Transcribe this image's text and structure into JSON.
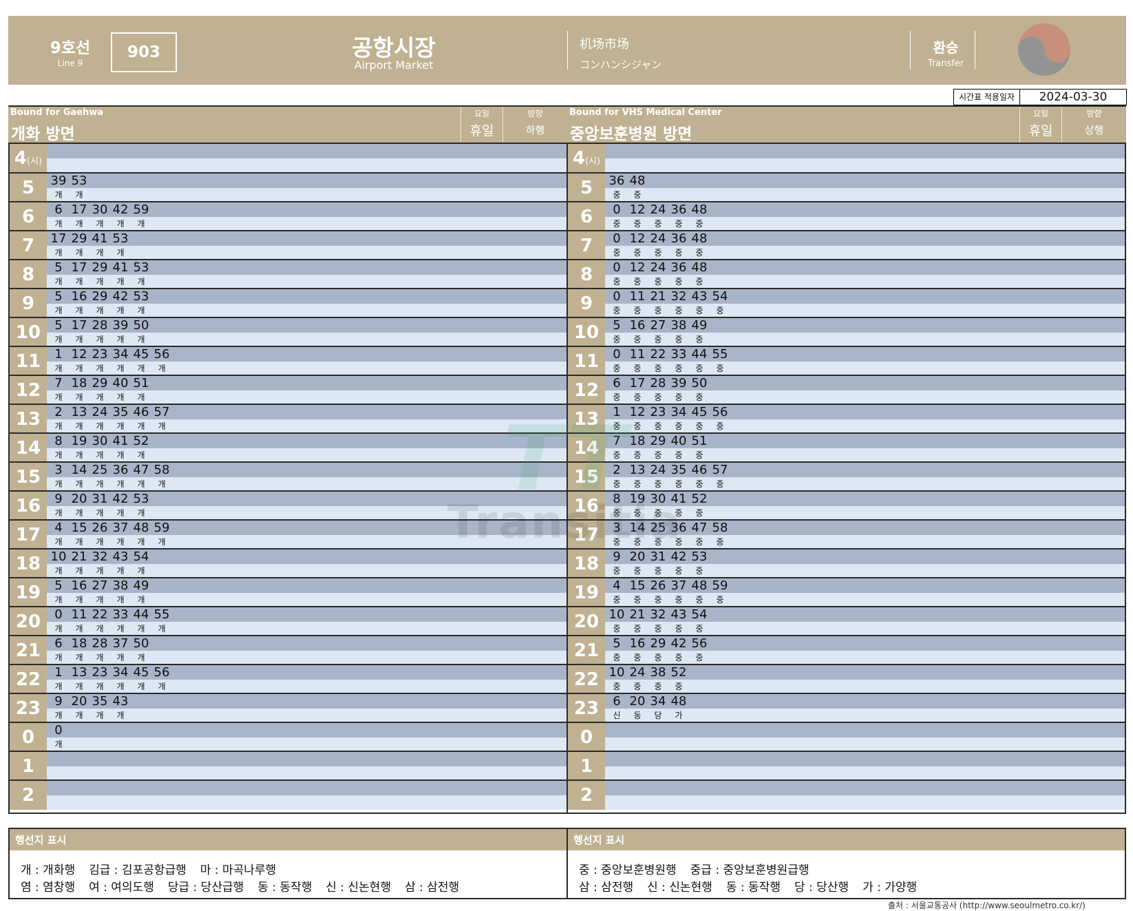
{
  "header": {
    "line_ko": "9호선",
    "line_en": "Line 9",
    "station_code": "903",
    "station_ko": "공항시장",
    "station_en": "Airport Market",
    "station_zh": "机场市场",
    "station_ja": "コンハンシジャン",
    "transfer_ko": "환승",
    "transfer_en": "Transfer",
    "logo_icon": "taegeuk-logo-icon"
  },
  "effective": {
    "label": "시간표 적용일자",
    "date": "2024-03-30"
  },
  "directions": [
    {
      "bound_en": "Bound for Gaehwa",
      "title_ko": "개화 방면",
      "day_label": "요일",
      "day_value": "휴일",
      "dir_label": "방향",
      "dir_value": "하행",
      "hours": [
        {
          "hour": "4",
          "unit": "(시)",
          "trains": []
        },
        {
          "hour": "5",
          "trains": [
            {
              "m": "39",
              "d": "개"
            },
            {
              "m": "53",
              "d": "개"
            }
          ]
        },
        {
          "hour": "6",
          "trains": [
            {
              "m": "6",
              "d": "개"
            },
            {
              "m": "17",
              "d": "개"
            },
            {
              "m": "30",
              "d": "개"
            },
            {
              "m": "42",
              "d": "개"
            },
            {
              "m": "59",
              "d": "개"
            }
          ]
        },
        {
          "hour": "7",
          "trains": [
            {
              "m": "17",
              "d": "개"
            },
            {
              "m": "29",
              "d": "개"
            },
            {
              "m": "41",
              "d": "개"
            },
            {
              "m": "53",
              "d": "개"
            }
          ]
        },
        {
          "hour": "8",
          "trains": [
            {
              "m": "5",
              "d": "개"
            },
            {
              "m": "17",
              "d": "개"
            },
            {
              "m": "29",
              "d": "개"
            },
            {
              "m": "41",
              "d": "개"
            },
            {
              "m": "53",
              "d": "개"
            }
          ]
        },
        {
          "hour": "9",
          "trains": [
            {
              "m": "5",
              "d": "개"
            },
            {
              "m": "16",
              "d": "개"
            },
            {
              "m": "29",
              "d": "개"
            },
            {
              "m": "42",
              "d": "개"
            },
            {
              "m": "53",
              "d": "개"
            }
          ]
        },
        {
          "hour": "10",
          "trains": [
            {
              "m": "5",
              "d": "개"
            },
            {
              "m": "17",
              "d": "개"
            },
            {
              "m": "28",
              "d": "개"
            },
            {
              "m": "39",
              "d": "개"
            },
            {
              "m": "50",
              "d": "개"
            }
          ]
        },
        {
          "hour": "11",
          "trains": [
            {
              "m": "1",
              "d": "개"
            },
            {
              "m": "12",
              "d": "개"
            },
            {
              "m": "23",
              "d": "개"
            },
            {
              "m": "34",
              "d": "개"
            },
            {
              "m": "45",
              "d": "개"
            },
            {
              "m": "56",
              "d": "개"
            }
          ]
        },
        {
          "hour": "12",
          "trains": [
            {
              "m": "7",
              "d": "개"
            },
            {
              "m": "18",
              "d": "개"
            },
            {
              "m": "29",
              "d": "개"
            },
            {
              "m": "40",
              "d": "개"
            },
            {
              "m": "51",
              "d": "개"
            }
          ]
        },
        {
          "hour": "13",
          "trains": [
            {
              "m": "2",
              "d": "개"
            },
            {
              "m": "13",
              "d": "개"
            },
            {
              "m": "24",
              "d": "개"
            },
            {
              "m": "35",
              "d": "개"
            },
            {
              "m": "46",
              "d": "개"
            },
            {
              "m": "57",
              "d": "개"
            }
          ]
        },
        {
          "hour": "14",
          "trains": [
            {
              "m": "8",
              "d": "개"
            },
            {
              "m": "19",
              "d": "개"
            },
            {
              "m": "30",
              "d": "개"
            },
            {
              "m": "41",
              "d": "개"
            },
            {
              "m": "52",
              "d": "개"
            }
          ]
        },
        {
          "hour": "15",
          "trains": [
            {
              "m": "3",
              "d": "개"
            },
            {
              "m": "14",
              "d": "개"
            },
            {
              "m": "25",
              "d": "개"
            },
            {
              "m": "36",
              "d": "개"
            },
            {
              "m": "47",
              "d": "개"
            },
            {
              "m": "58",
              "d": "개"
            }
          ]
        },
        {
          "hour": "16",
          "trains": [
            {
              "m": "9",
              "d": "개"
            },
            {
              "m": "20",
              "d": "개"
            },
            {
              "m": "31",
              "d": "개"
            },
            {
              "m": "42",
              "d": "개"
            },
            {
              "m": "53",
              "d": "개"
            }
          ]
        },
        {
          "hour": "17",
          "trains": [
            {
              "m": "4",
              "d": "개"
            },
            {
              "m": "15",
              "d": "개"
            },
            {
              "m": "26",
              "d": "개"
            },
            {
              "m": "37",
              "d": "개"
            },
            {
              "m": "48",
              "d": "개"
            },
            {
              "m": "59",
              "d": "개"
            }
          ]
        },
        {
          "hour": "18",
          "trains": [
            {
              "m": "10",
              "d": "개"
            },
            {
              "m": "21",
              "d": "개"
            },
            {
              "m": "32",
              "d": "개"
            },
            {
              "m": "43",
              "d": "개"
            },
            {
              "m": "54",
              "d": "개"
            }
          ]
        },
        {
          "hour": "19",
          "trains": [
            {
              "m": "5",
              "d": "개"
            },
            {
              "m": "16",
              "d": "개"
            },
            {
              "m": "27",
              "d": "개"
            },
            {
              "m": "38",
              "d": "개"
            },
            {
              "m": "49",
              "d": "개"
            }
          ]
        },
        {
          "hour": "20",
          "trains": [
            {
              "m": "0",
              "d": "개"
            },
            {
              "m": "11",
              "d": "개"
            },
            {
              "m": "22",
              "d": "개"
            },
            {
              "m": "33",
              "d": "개"
            },
            {
              "m": "44",
              "d": "개"
            },
            {
              "m": "55",
              "d": "개"
            }
          ]
        },
        {
          "hour": "21",
          "trains": [
            {
              "m": "6",
              "d": "개"
            },
            {
              "m": "18",
              "d": "개"
            },
            {
              "m": "28",
              "d": "개"
            },
            {
              "m": "37",
              "d": "개"
            },
            {
              "m": "50",
              "d": "개"
            }
          ]
        },
        {
          "hour": "22",
          "trains": [
            {
              "m": "1",
              "d": "개"
            },
            {
              "m": "13",
              "d": "개"
            },
            {
              "m": "23",
              "d": "개"
            },
            {
              "m": "34",
              "d": "개"
            },
            {
              "m": "45",
              "d": "개"
            },
            {
              "m": "56",
              "d": "개"
            }
          ]
        },
        {
          "hour": "23",
          "trains": [
            {
              "m": "9",
              "d": "개"
            },
            {
              "m": "20",
              "d": "개"
            },
            {
              "m": "35",
              "d": "개"
            },
            {
              "m": "43",
              "d": "개"
            }
          ]
        },
        {
          "hour": "0",
          "trains": [
            {
              "m": "0",
              "d": "개"
            }
          ]
        },
        {
          "hour": "1",
          "trains": []
        },
        {
          "hour": "2",
          "trains": []
        }
      ]
    },
    {
      "bound_en": "Bound for VHS Medical Center",
      "title_ko": "중앙보훈병원 방면",
      "day_label": "요일",
      "day_value": "휴일",
      "dir_label": "방향",
      "dir_value": "상행",
      "hours": [
        {
          "hour": "4",
          "unit": "(시)",
          "trains": []
        },
        {
          "hour": "5",
          "trains": [
            {
              "m": "36",
              "d": "중"
            },
            {
              "m": "48",
              "d": "중"
            }
          ]
        },
        {
          "hour": "6",
          "trains": [
            {
              "m": "0",
              "d": "중"
            },
            {
              "m": "12",
              "d": "중"
            },
            {
              "m": "24",
              "d": "중"
            },
            {
              "m": "36",
              "d": "중"
            },
            {
              "m": "48",
              "d": "중"
            }
          ]
        },
        {
          "hour": "7",
          "trains": [
            {
              "m": "0",
              "d": "중"
            },
            {
              "m": "12",
              "d": "중"
            },
            {
              "m": "24",
              "d": "중"
            },
            {
              "m": "36",
              "d": "중"
            },
            {
              "m": "48",
              "d": "중"
            }
          ]
        },
        {
          "hour": "8",
          "trains": [
            {
              "m": "0",
              "d": "중"
            },
            {
              "m": "12",
              "d": "중"
            },
            {
              "m": "24",
              "d": "중"
            },
            {
              "m": "36",
              "d": "중"
            },
            {
              "m": "48",
              "d": "중"
            }
          ]
        },
        {
          "hour": "9",
          "trains": [
            {
              "m": "0",
              "d": "중"
            },
            {
              "m": "11",
              "d": "중"
            },
            {
              "m": "21",
              "d": "중"
            },
            {
              "m": "32",
              "d": "중"
            },
            {
              "m": "43",
              "d": "중"
            },
            {
              "m": "54",
              "d": "중"
            }
          ]
        },
        {
          "hour": "10",
          "trains": [
            {
              "m": "5",
              "d": "중"
            },
            {
              "m": "16",
              "d": "중"
            },
            {
              "m": "27",
              "d": "중"
            },
            {
              "m": "38",
              "d": "중"
            },
            {
              "m": "49",
              "d": "중"
            }
          ]
        },
        {
          "hour": "11",
          "trains": [
            {
              "m": "0",
              "d": "중"
            },
            {
              "m": "11",
              "d": "중"
            },
            {
              "m": "22",
              "d": "중"
            },
            {
              "m": "33",
              "d": "중"
            },
            {
              "m": "44",
              "d": "중"
            },
            {
              "m": "55",
              "d": "중"
            }
          ]
        },
        {
          "hour": "12",
          "trains": [
            {
              "m": "6",
              "d": "중"
            },
            {
              "m": "17",
              "d": "중"
            },
            {
              "m": "28",
              "d": "중"
            },
            {
              "m": "39",
              "d": "중"
            },
            {
              "m": "50",
              "d": "중"
            }
          ]
        },
        {
          "hour": "13",
          "trains": [
            {
              "m": "1",
              "d": "중"
            },
            {
              "m": "12",
              "d": "중"
            },
            {
              "m": "23",
              "d": "중"
            },
            {
              "m": "34",
              "d": "중"
            },
            {
              "m": "45",
              "d": "중"
            },
            {
              "m": "56",
              "d": "중"
            }
          ]
        },
        {
          "hour": "14",
          "trains": [
            {
              "m": "7",
              "d": "중"
            },
            {
              "m": "18",
              "d": "중"
            },
            {
              "m": "29",
              "d": "중"
            },
            {
              "m": "40",
              "d": "중"
            },
            {
              "m": "51",
              "d": "중"
            }
          ]
        },
        {
          "hour": "15",
          "trains": [
            {
              "m": "2",
              "d": "중"
            },
            {
              "m": "13",
              "d": "중"
            },
            {
              "m": "24",
              "d": "중"
            },
            {
              "m": "35",
              "d": "중"
            },
            {
              "m": "46",
              "d": "중"
            },
            {
              "m": "57",
              "d": "중"
            }
          ]
        },
        {
          "hour": "16",
          "trains": [
            {
              "m": "8",
              "d": "중"
            },
            {
              "m": "19",
              "d": "중"
            },
            {
              "m": "30",
              "d": "중"
            },
            {
              "m": "41",
              "d": "중"
            },
            {
              "m": "52",
              "d": "중"
            }
          ]
        },
        {
          "hour": "17",
          "trains": [
            {
              "m": "3",
              "d": "중"
            },
            {
              "m": "14",
              "d": "중"
            },
            {
              "m": "25",
              "d": "중"
            },
            {
              "m": "36",
              "d": "중"
            },
            {
              "m": "47",
              "d": "중"
            },
            {
              "m": "58",
              "d": "중"
            }
          ]
        },
        {
          "hour": "18",
          "trains": [
            {
              "m": "9",
              "d": "중"
            },
            {
              "m": "20",
              "d": "중"
            },
            {
              "m": "31",
              "d": "중"
            },
            {
              "m": "42",
              "d": "중"
            },
            {
              "m": "53",
              "d": "중"
            }
          ]
        },
        {
          "hour": "19",
          "trains": [
            {
              "m": "4",
              "d": "중"
            },
            {
              "m": "15",
              "d": "중"
            },
            {
              "m": "26",
              "d": "중"
            },
            {
              "m": "37",
              "d": "중"
            },
            {
              "m": "48",
              "d": "중"
            },
            {
              "m": "59",
              "d": "중"
            }
          ]
        },
        {
          "hour": "20",
          "trains": [
            {
              "m": "10",
              "d": "중"
            },
            {
              "m": "21",
              "d": "중"
            },
            {
              "m": "32",
              "d": "중"
            },
            {
              "m": "43",
              "d": "중"
            },
            {
              "m": "54",
              "d": "중"
            }
          ]
        },
        {
          "hour": "21",
          "trains": [
            {
              "m": "5",
              "d": "중"
            },
            {
              "m": "16",
              "d": "중"
            },
            {
              "m": "29",
              "d": "중"
            },
            {
              "m": "42",
              "d": "중"
            },
            {
              "m": "56",
              "d": "중"
            }
          ]
        },
        {
          "hour": "22",
          "trains": [
            {
              "m": "10",
              "d": "중"
            },
            {
              "m": "24",
              "d": "중"
            },
            {
              "m": "38",
              "d": "중"
            },
            {
              "m": "52",
              "d": "중"
            }
          ]
        },
        {
          "hour": "23",
          "trains": [
            {
              "m": "6",
              "d": "신"
            },
            {
              "m": "20",
              "d": "동"
            },
            {
              "m": "34",
              "d": "당"
            },
            {
              "m": "48",
              "d": "가"
            }
          ]
        },
        {
          "hour": "0",
          "trains": []
        },
        {
          "hour": "1",
          "trains": []
        },
        {
          "hour": "2",
          "trains": []
        }
      ]
    }
  ],
  "watermark": {
    "logo": "TT",
    "text": "Transitia"
  },
  "legend": [
    {
      "title": "행선지 표시",
      "lines": [
        [
          "개 : 개화행",
          "김급 : 김포공항급행",
          "마 : 마곡나루행"
        ],
        [
          "염 : 염창행",
          "여 : 여의도행",
          "당급 : 당산급행",
          "동 : 동작행",
          "신 : 신논현행",
          "삼 : 삼전행"
        ]
      ]
    },
    {
      "title": "행선지 표시",
      "lines": [
        [
          "중 : 중앙보훈병원행",
          "중급 : 중앙보훈병원급행"
        ],
        [
          "삼 : 삼전행",
          "신 : 신논현행",
          "동 : 동작행",
          "당 : 당산행",
          "가 : 가양행"
        ]
      ]
    }
  ],
  "source": "출처 : 서울교통공사 (http://www.seoulmetro.co.kr/)"
}
